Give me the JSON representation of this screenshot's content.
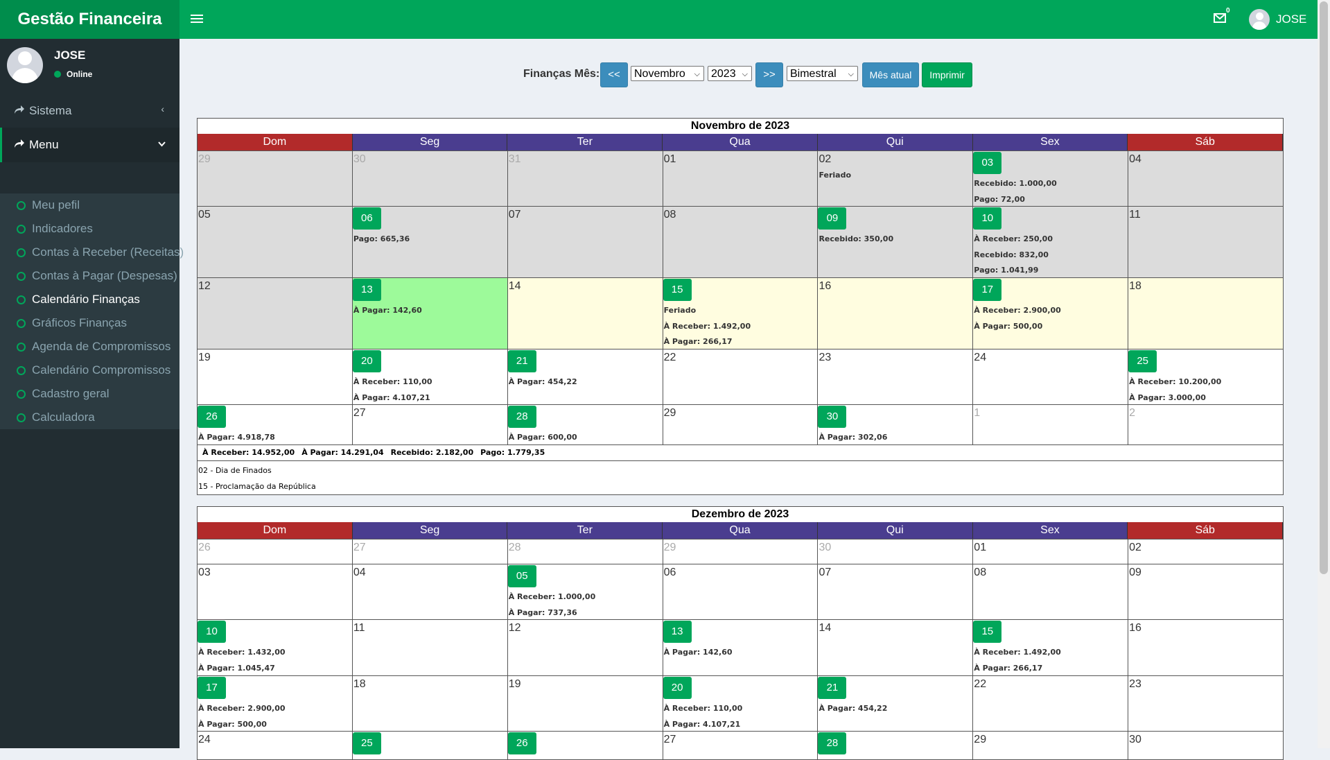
{
  "app": {
    "title": "Gestão Financeira"
  },
  "header": {
    "user_name": "JOSE",
    "mail_count": "0"
  },
  "sidebar": {
    "user_name": "JOSE",
    "status": "Online",
    "sistema_label": "Sistema",
    "menu_label": "Menu",
    "items": [
      {
        "label": "Meu pefil"
      },
      {
        "label": "Indicadores"
      },
      {
        "label": "Contas à Receber (Receitas)"
      },
      {
        "label": "Contas à Pagar (Despesas)"
      },
      {
        "label": "Calendário Finanças",
        "active": true
      },
      {
        "label": "Gráficos Finanças"
      },
      {
        "label": "Agenda de Compromissos"
      },
      {
        "label": "Calendário Compromissos"
      },
      {
        "label": "Cadastro geral"
      },
      {
        "label": "Calculadora"
      }
    ]
  },
  "toolbar": {
    "label": "Finanças Mês:",
    "prev": "<<",
    "month": "Novembro",
    "year": "2023",
    "next": ">>",
    "period": "Bimestral",
    "current_month": "Mês atual",
    "print": "Imprimir"
  },
  "weekdays": [
    "Dom",
    "Seg",
    "Ter",
    "Qua",
    "Qui",
    "Sex",
    "Sáb"
  ],
  "calendars": [
    {
      "title": "Novembro de 2023",
      "weeks": [
        {
          "days": [
            {
              "d": "29",
              "out": true,
              "bg": "past"
            },
            {
              "d": "30",
              "out": true,
              "bg": "past"
            },
            {
              "d": "31",
              "out": true,
              "bg": "past"
            },
            {
              "d": "01",
              "bg": "past"
            },
            {
              "d": "02",
              "bg": "past",
              "events": [
                "Feriado"
              ]
            },
            {
              "d": "03",
              "btn": true,
              "bg": "past",
              "events": [
                "Recebido: 1.000,00",
                "Pago: 72,00"
              ]
            },
            {
              "d": "04",
              "bg": "past"
            }
          ]
        },
        {
          "days": [
            {
              "d": "05",
              "bg": "past"
            },
            {
              "d": "06",
              "btn": true,
              "bg": "past",
              "events": [
                "Pago: 665,36"
              ]
            },
            {
              "d": "07",
              "bg": "past"
            },
            {
              "d": "08",
              "bg": "past"
            },
            {
              "d": "09",
              "btn": true,
              "bg": "past",
              "events": [
                "Recebido: 350,00"
              ]
            },
            {
              "d": "10",
              "btn": true,
              "bg": "past",
              "events": [
                "À Receber: 250,00",
                "Recebido: 832,00",
                "Pago: 1.041,99"
              ]
            },
            {
              "d": "11",
              "bg": "past"
            }
          ]
        },
        {
          "days": [
            {
              "d": "12",
              "bg": "past"
            },
            {
              "d": "13",
              "btn": true,
              "bg": "today",
              "events": [
                "À Pagar: 142,60"
              ]
            },
            {
              "d": "14",
              "bg": "cur"
            },
            {
              "d": "15",
              "btn": true,
              "bg": "cur",
              "events": [
                "Feriado",
                "À Receber: 1.492,00",
                "À Pagar: 266,17"
              ]
            },
            {
              "d": "16",
              "bg": "cur"
            },
            {
              "d": "17",
              "btn": true,
              "bg": "cur",
              "events": [
                "À Receber: 2.900,00",
                "À Pagar: 500,00"
              ]
            },
            {
              "d": "18",
              "bg": "cur"
            }
          ]
        },
        {
          "days": [
            {
              "d": "19"
            },
            {
              "d": "20",
              "btn": true,
              "events": [
                "À Receber: 110,00",
                "À Pagar: 4.107,21"
              ]
            },
            {
              "d": "21",
              "btn": true,
              "events": [
                "À Pagar: 454,22"
              ]
            },
            {
              "d": "22"
            },
            {
              "d": "23"
            },
            {
              "d": "24"
            },
            {
              "d": "25",
              "btn": true,
              "events": [
                "À Receber: 10.200,00",
                "À Pagar: 3.000,00"
              ]
            }
          ]
        },
        {
          "days": [
            {
              "d": "26",
              "btn": true,
              "events": [
                "À Pagar: 4.918,78"
              ]
            },
            {
              "d": "27"
            },
            {
              "d": "28",
              "btn": true,
              "events": [
                "À Pagar: 600,00"
              ]
            },
            {
              "d": "29"
            },
            {
              "d": "30",
              "btn": true,
              "events": [
                "À Pagar: 302,06"
              ]
            },
            {
              "d": "1",
              "out": true
            },
            {
              "d": "2",
              "out": true
            }
          ]
        }
      ],
      "totals": [
        "À Receber: 14.952,00",
        "À Pagar: 14.291,04",
        "Recebido: 2.182,00",
        "Pago: 1.779,35"
      ],
      "holidays": [
        "02 - Dia de Finados",
        "15 - Proclamação da República"
      ]
    },
    {
      "title": "Dezembro de 2023",
      "weeks": [
        {
          "days": [
            {
              "d": "26",
              "out": true
            },
            {
              "d": "27",
              "out": true
            },
            {
              "d": "28",
              "out": true
            },
            {
              "d": "29",
              "out": true
            },
            {
              "d": "30",
              "out": true
            },
            {
              "d": "01"
            },
            {
              "d": "02"
            }
          ]
        },
        {
          "days": [
            {
              "d": "03"
            },
            {
              "d": "04"
            },
            {
              "d": "05",
              "btn": true,
              "events": [
                "À Receber: 1.000,00",
                "À Pagar: 737,36"
              ]
            },
            {
              "d": "06"
            },
            {
              "d": "07"
            },
            {
              "d": "08"
            },
            {
              "d": "09"
            }
          ]
        },
        {
          "days": [
            {
              "d": "10",
              "btn": true,
              "events": [
                "À Receber: 1.432,00",
                "À Pagar: 1.045,47"
              ]
            },
            {
              "d": "11"
            },
            {
              "d": "12"
            },
            {
              "d": "13",
              "btn": true,
              "events": [
                "À Pagar: 142,60"
              ]
            },
            {
              "d": "14"
            },
            {
              "d": "15",
              "btn": true,
              "events": [
                "À Receber: 1.492,00",
                "À Pagar: 266,17"
              ]
            },
            {
              "d": "16"
            }
          ]
        },
        {
          "days": [
            {
              "d": "17",
              "btn": true,
              "events": [
                "À Receber: 2.900,00",
                "À Pagar: 500,00"
              ]
            },
            {
              "d": "18"
            },
            {
              "d": "19"
            },
            {
              "d": "20",
              "btn": true,
              "events": [
                "À Receber: 110,00",
                "À Pagar: 4.107,21"
              ]
            },
            {
              "d": "21",
              "btn": true,
              "events": [
                "À Pagar: 454,22"
              ]
            },
            {
              "d": "22"
            },
            {
              "d": "23"
            }
          ]
        },
        {
          "days": [
            {
              "d": "24"
            },
            {
              "d": "25",
              "btn": true
            },
            {
              "d": "26",
              "btn": true
            },
            {
              "d": "27"
            },
            {
              "d": "28",
              "btn": true
            },
            {
              "d": "29"
            },
            {
              "d": "30"
            }
          ]
        }
      ]
    }
  ],
  "colors": {
    "primary": "#00a65a",
    "primary_dark": "#008d4c",
    "sidebar": "#222d32",
    "weekday": "#4a3d8f",
    "weekend": "#b22a2a",
    "blue_button": "#3c8dbc"
  }
}
